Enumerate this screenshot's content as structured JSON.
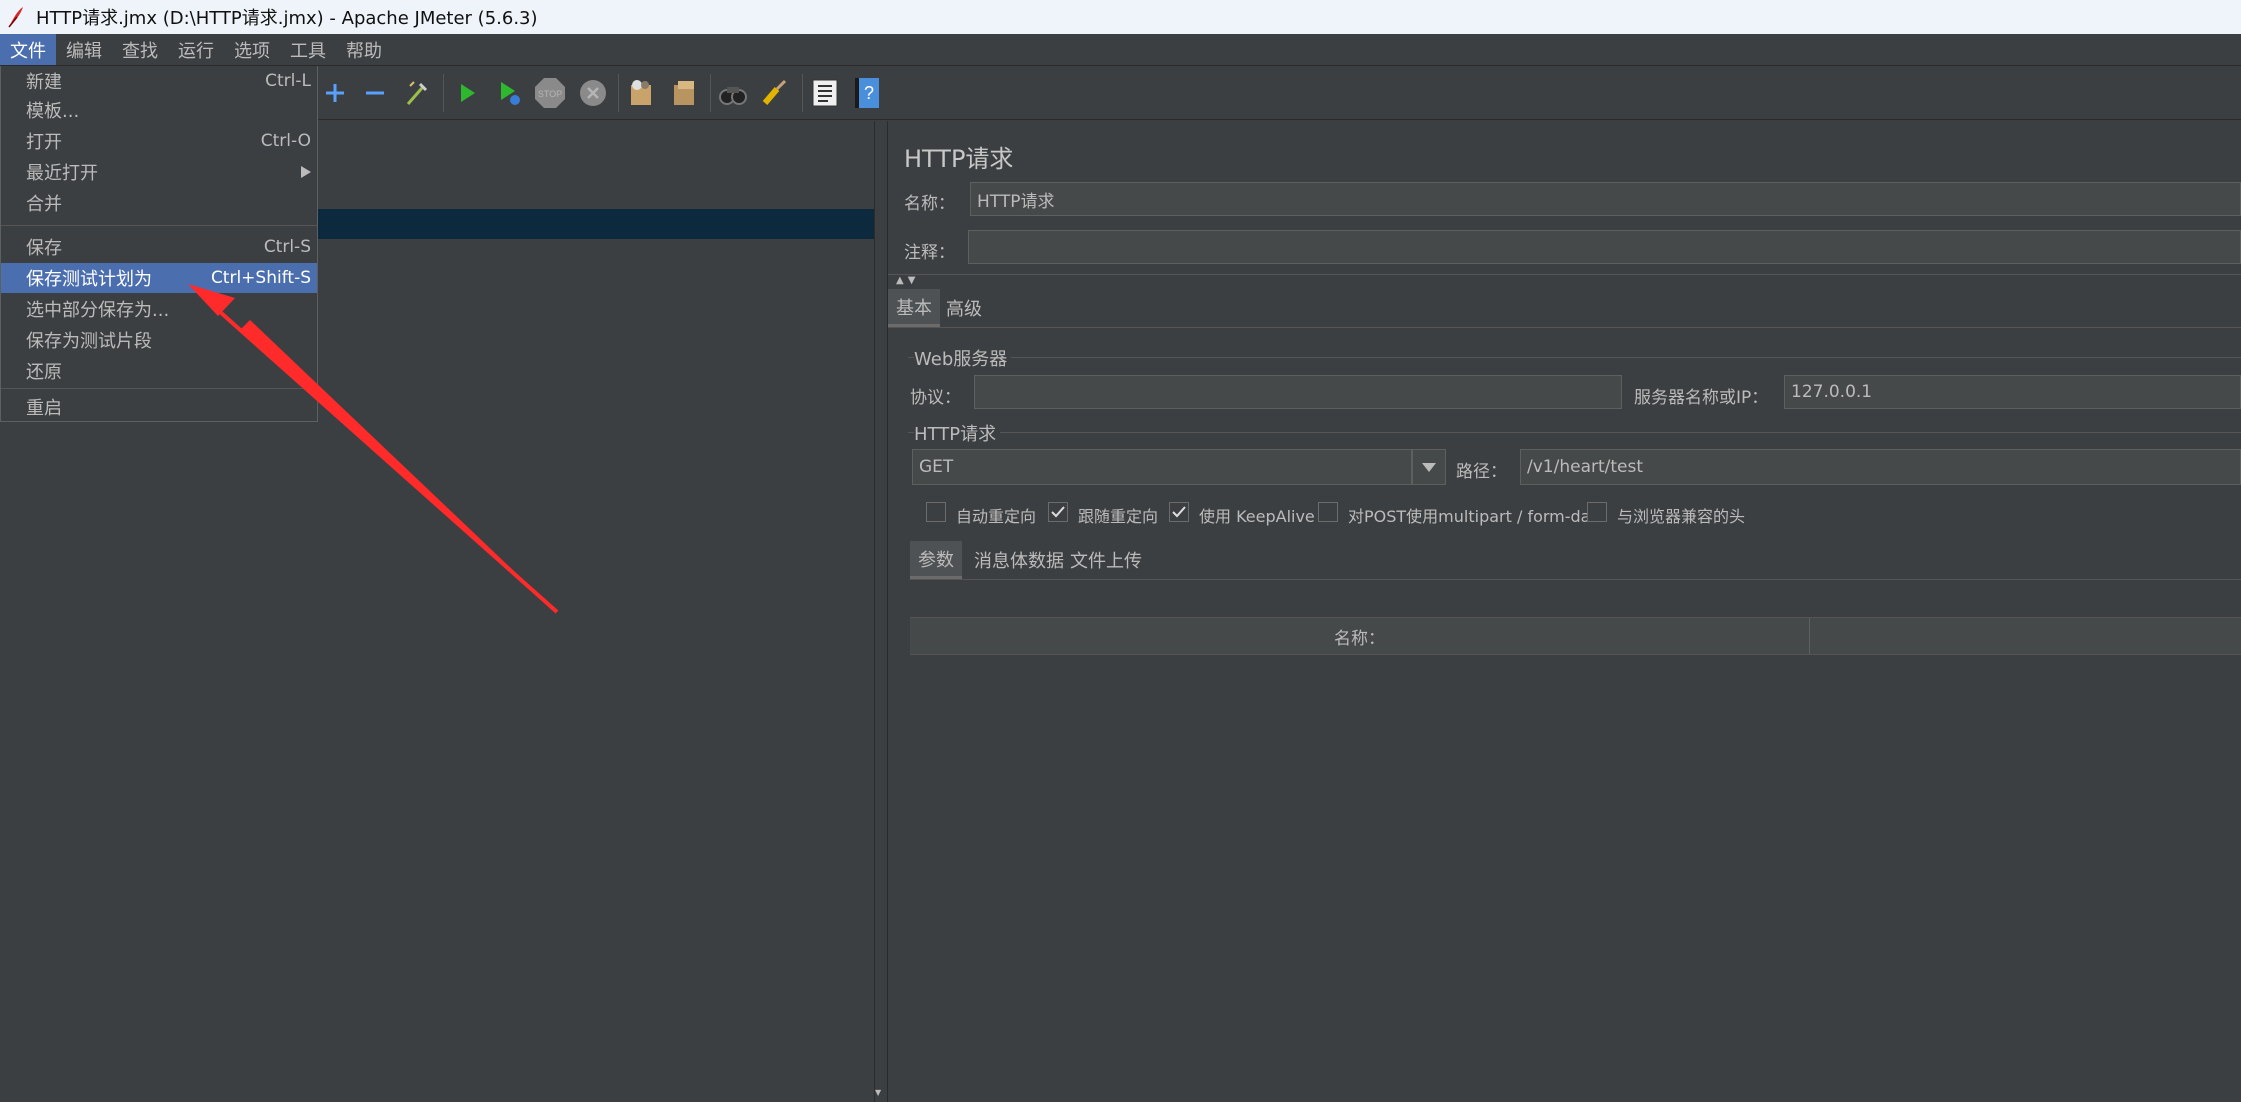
{
  "window": {
    "title": "HTTP请求.jmx (D:\\HTTP请求.jmx) - Apache JMeter (5.6.3)"
  },
  "menubar": {
    "items": [
      "文件",
      "编辑",
      "查找",
      "运行",
      "选项",
      "工具",
      "帮助"
    ]
  },
  "file_menu": {
    "items": [
      {
        "label": "新建",
        "shortcut": "Ctrl-L"
      },
      {
        "label": "模板...",
        "shortcut": ""
      },
      {
        "label": "打开",
        "shortcut": "Ctrl-O"
      },
      {
        "label": "最近打开",
        "shortcut": ""
      },
      {
        "label": "合并",
        "shortcut": ""
      },
      {
        "label": "保存",
        "shortcut": "Ctrl-S"
      },
      {
        "label": "保存测试计划为",
        "shortcut": "Ctrl+Shift-S"
      },
      {
        "label": "选中部分保存为...",
        "shortcut": ""
      },
      {
        "label": "保存为测试片段",
        "shortcut": ""
      },
      {
        "label": "还原",
        "shortcut": ""
      },
      {
        "label": "重启",
        "shortcut": ""
      }
    ]
  },
  "toolbar": {
    "icons": [
      "add-icon",
      "remove-icon",
      "toggle-icon",
      "start-icon",
      "start-no-pause-icon",
      "stop-icon",
      "shutdown-icon",
      "clear-icon",
      "clear-all-icon",
      "search-icon",
      "reset-search-icon",
      "function-helper-icon",
      "help-icon"
    ],
    "stop_label": "STOP"
  },
  "http_request": {
    "title": "HTTP请求",
    "name_label": "名称：",
    "name_value": "HTTP请求",
    "comment_label": "注释：",
    "comment_value": "",
    "tabs": [
      "基本",
      "高级"
    ],
    "web_server_section": "Web服务器",
    "protocol_label": "协议：",
    "protocol_value": "",
    "server_label": "服务器名称或IP：",
    "server_value": "127.0.0.1",
    "http_section": "HTTP请求",
    "method_value": "GET",
    "path_label": "路径：",
    "path_value": "/v1/heart/test",
    "checkboxes": [
      {
        "label": "自动重定向",
        "checked": false
      },
      {
        "label": "跟随重定向",
        "checked": true
      },
      {
        "label": "使用 KeepAlive",
        "checked": true
      },
      {
        "label": "对POST使用multipart / form-data",
        "checked": false
      },
      {
        "label": "与浏览器兼容的头",
        "checked": false
      }
    ],
    "body_tabs": [
      "参数",
      "消息体数据",
      "文件上传"
    ],
    "table_header_name": "名称："
  },
  "colors": {
    "background": "#3c3f41",
    "menu_highlight": "#4b6eaf",
    "tree_selection": "#0d293e",
    "annotation_arrow": "#ff2a2a"
  }
}
